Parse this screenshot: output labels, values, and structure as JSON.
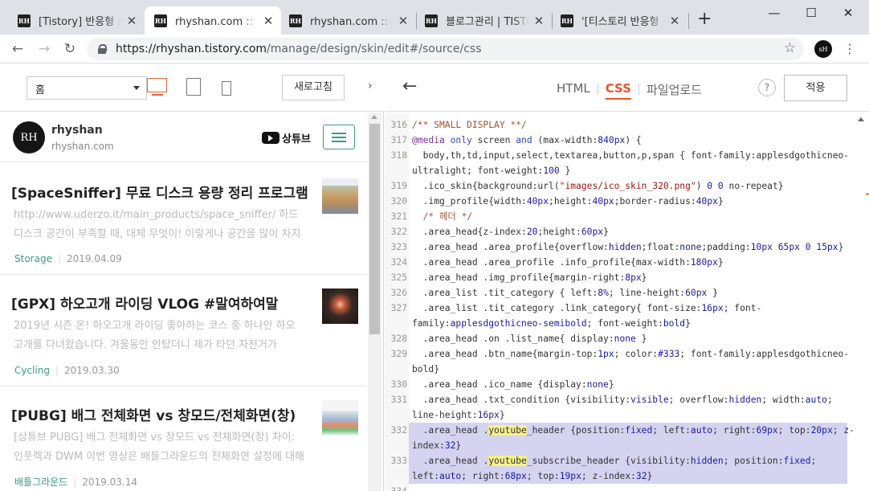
{
  "browser": {
    "tabs": [
      {
        "favicon": "RH",
        "title": "[Tistory] 반응형 스킨",
        "active": false
      },
      {
        "favicon": "RH",
        "title": "rhyshan.com :: 스킨",
        "active": true
      },
      {
        "favicon": "RH",
        "title": "rhyshan.com :: 스킨",
        "active": false
      },
      {
        "favicon": "RH",
        "title": "블로그관리 | TISTORY",
        "active": false
      },
      {
        "favicon": "RH",
        "title": "'[티스토리 반응형 스킨",
        "active": false
      }
    ],
    "new_tab_icon": "plus-icon",
    "window_controls": [
      "minimize-icon",
      "maximize-icon",
      "close-icon"
    ],
    "url_host": "https://rhyshan.tistory.com",
    "url_path": "/manage/design/skin/edit#/source/css",
    "profile_initials": "sH"
  },
  "preview": {
    "page_select": "홈",
    "refresh_label": "새로고침",
    "blog_name": "rhyshan",
    "blog_url": "rhyshan.com",
    "avatar_text": "RH",
    "youtube_label": "상튜브",
    "posts": [
      {
        "title": "[SpaceSniffer] 무료 디스크 용량 정리 프로그램",
        "desc": "http://www.uderzo.it/main_products/space_sniffer/ 하드디스크 공간이 부족할 때, 대체 무엇이! 이렇게나 공간을 많이 차지하고 있는지",
        "category": "Storage",
        "date": "2019.04.09"
      },
      {
        "title": "[GPX] 하오고개 라이딩 VLOG #말여하여말",
        "desc": "2019년 시즌 온! 하오고개 라이딩 좋아하는 코스 중 하나인 하오고개를 다녀왔습니다. 겨울동안 안탔더니 제가 타던 자전거가",
        "category": "Cycling",
        "date": "2019.03.30"
      },
      {
        "title": "[PUBG] 배그 전체화면 vs 창모드/전체화면(창)",
        "desc": "[상튜브 PUBG] 배그 전체화면 vs 창모드 vs 전체화면(창) 차이: 인풋렉과 DWM 이번 영상은 배틀그라운드의 전체화면 설정에 대해",
        "category": "배틀그라운드",
        "date": "2019.03.14"
      }
    ]
  },
  "editor": {
    "tabs": [
      "HTML",
      "CSS",
      "파일업로드"
    ],
    "active_tab": "CSS",
    "help_label": "?",
    "apply_label": "적용",
    "highlight_word": "youtube",
    "lines": [
      {
        "num": "316",
        "text": "/** SMALL DISPLAY **/"
      },
      {
        "num": "317",
        "text": "@media only screen and (max-width:840px) {"
      },
      {
        "num": "318",
        "text": "  body,th,td,input,select,textarea,button,p,span { font-family:applesdgothicneo-"
      },
      {
        "num": "",
        "text": "ultralight; font-weight:100 }"
      },
      {
        "num": "319",
        "text": "  .ico_skin{background:url(\"images/ico_skin_320.png\") 0 0 no-repeat}"
      },
      {
        "num": "320",
        "text": "  .img_profile{width:40px;height:40px;border-radius:40px}"
      },
      {
        "num": "321",
        "text": "  /* 헤더 */"
      },
      {
        "num": "322",
        "text": "  .area_head{z-index:20;height:60px}"
      },
      {
        "num": "323",
        "text": "  .area_head .area_profile{overflow:hidden;float:none;padding:10px 65px 0 15px}"
      },
      {
        "num": "324",
        "text": "  .area_head .area_profile .info_profile{max-width:180px}"
      },
      {
        "num": "325",
        "text": "  .area_head .img_profile{margin-right:8px}"
      },
      {
        "num": "326",
        "text": "  .area_list .tit_category { left:8%; line-height:60px }"
      },
      {
        "num": "327",
        "text": "  .area_list .tit_category .link_category{ font-size:16px; font-"
      },
      {
        "num": "",
        "text": "family:applesdgothicneo-semibold; font-weight:bold}"
      },
      {
        "num": "328",
        "text": "  .area_head .on .list_name{ display:none }"
      },
      {
        "num": "329",
        "text": "  .area_head .btn_name{margin-top:1px; color:#333; font-family:applesdgothicneo-"
      },
      {
        "num": "",
        "text": "bold}"
      },
      {
        "num": "330",
        "text": "  .area_head .ico_name {display:none}"
      },
      {
        "num": "331",
        "text": "  .area_head .txt_condition {visibility:visible; overflow:hidden; width:auto;"
      },
      {
        "num": "",
        "text": "line-height:16px}"
      },
      {
        "num": "332",
        "text": "  .area_head .youtube_header {position:fixed; left:auto; right:69px; top:20px; z-"
      },
      {
        "num": "",
        "text": "index:32}"
      },
      {
        "num": "333",
        "text": "  .area_head .youtube_subscribe_header {visibility:hidden; position:fixed;"
      },
      {
        "num": "",
        "text": "left:auto; right:68px; top:19px; z-index:32}"
      },
      {
        "num": "334",
        "text": ""
      }
    ]
  }
}
